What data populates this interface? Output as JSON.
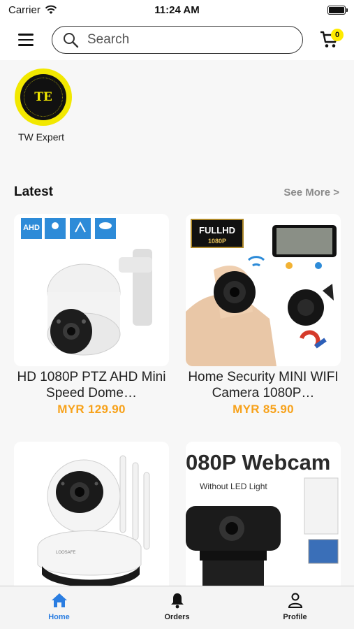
{
  "status_bar": {
    "carrier": "Carrier",
    "time": "11:24 AM"
  },
  "header": {
    "search": {
      "placeholder": "Search",
      "value": ""
    },
    "cart_count": "0"
  },
  "store": {
    "logo_text": "TE",
    "name": "TW Expert"
  },
  "latest": {
    "title": "Latest",
    "see_more": "See More >",
    "products": [
      {
        "title": "HD 1080P PTZ AHD Mini Speed Dome…",
        "price": "MYR 129.90"
      },
      {
        "title": "Home Security MINI WIFI Camera 1080P…",
        "price": "MYR 85.90"
      },
      {
        "title": "",
        "price": ""
      },
      {
        "title": "",
        "price": ""
      }
    ],
    "image_text": {
      "badge_ahd": "AHD",
      "badge_fullhd": "FULLHD",
      "badge_1080p": "1080P",
      "webcam_heading": "080P Webcam",
      "webcam_sub": "Without LED Light",
      "webcam_brand": "LOOSAFE"
    }
  },
  "tabs": [
    {
      "label": "Home",
      "icon": "home-icon",
      "active": true
    },
    {
      "label": "Orders",
      "icon": "bell-icon",
      "active": false
    },
    {
      "label": "Profile",
      "icon": "person-icon",
      "active": false
    }
  ],
  "colors": {
    "accent": "#2a7de1",
    "price": "#f7a21b",
    "logo_yellow": "#f2e800"
  }
}
